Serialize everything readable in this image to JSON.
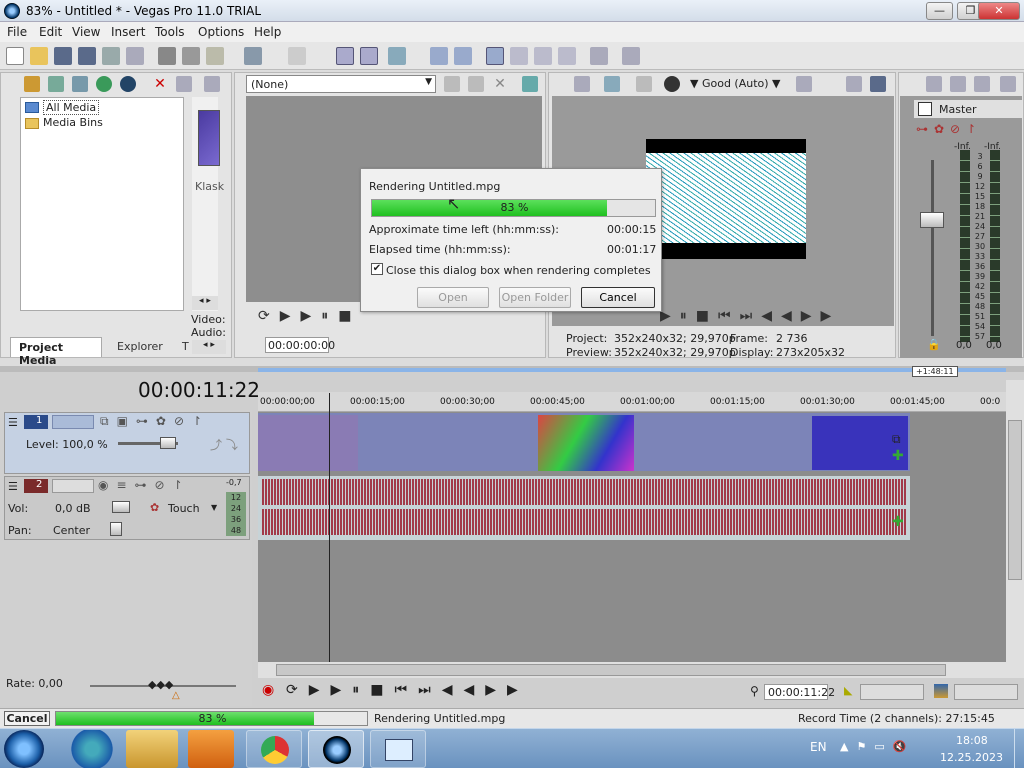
{
  "window": {
    "title": "83% - Untitled * - Vegas Pro 11.0 TRIAL",
    "minimize": "—",
    "maximize": "❐",
    "close": "✕"
  },
  "menu": [
    "File",
    "Edit",
    "View",
    "Insert",
    "Tools",
    "Options",
    "Help"
  ],
  "project_media": {
    "tree": [
      "All Media",
      "Media Bins"
    ],
    "thumb_label": "Klask",
    "tabs": [
      "Project Media",
      "Explorer",
      "T"
    ],
    "side_labels": [
      "Video:",
      "Audio:"
    ]
  },
  "trimmer": {
    "select_value": "(None)",
    "timecode": "00:00:00:00"
  },
  "preview": {
    "quality": "Good (Auto)",
    "project_label": "Project:",
    "project_value": "352x240x32; 29,970p",
    "preview_label": "Preview:",
    "preview_value": "352x240x32; 29,970p",
    "frame_label": "Frame:",
    "frame_value": "2 736",
    "display_label": "Display:",
    "display_value": "273x205x32"
  },
  "mixer": {
    "title": "Master",
    "inf_left": "-Inf.",
    "inf_right": "-Inf.",
    "scale": [
      "3",
      "6",
      "9",
      "12",
      "15",
      "18",
      "21",
      "24",
      "27",
      "30",
      "33",
      "36",
      "39",
      "42",
      "45",
      "48",
      "51",
      "54",
      "57"
    ],
    "bottom_left": "0,0",
    "bottom_right": "0,0"
  },
  "timeline": {
    "timecode": "00:00:11:22",
    "region_marker": "+1:48:11",
    "ruler": [
      "00:00:00;00",
      "00:00:15;00",
      "00:00:30;00",
      "00:00:45;00",
      "00:01:00;00",
      "00:01:15;00",
      "00:01:30;00",
      "00:01:45;00",
      "00:0"
    ]
  },
  "tracks": {
    "video": {
      "number": "1",
      "level": "Level: 100,0 %"
    },
    "audio": {
      "number": "2",
      "vol_label": "Vol:",
      "vol_value": "0,0 dB",
      "pan_label": "Pan:",
      "pan_value": "Center",
      "touch": "Touch",
      "meter_top": "-0,7",
      "meter_scale": [
        "12",
        "24",
        "36",
        "48"
      ]
    }
  },
  "transport": {
    "rate": "Rate: 0,00",
    "timecode": "00:00:11:22"
  },
  "status": {
    "cancel": "Cancel",
    "progress": 83,
    "progress_text": "83 %",
    "rendering": "Rendering Untitled.mpg",
    "record_time": "Record Time (2 channels): 27:15:45"
  },
  "dialog": {
    "title": "Rendering Untitled.mpg",
    "progress": 83,
    "progress_text": "83 %",
    "time_left_label": "Approximate time left (hh:mm:ss):",
    "time_left_value": "00:00:15",
    "elapsed_label": "Elapsed time (hh:mm:ss):",
    "elapsed_value": "00:01:17",
    "checkbox_label": "Close this dialog box when rendering completes",
    "checkbox_checked": true,
    "open": "Open",
    "open_folder": "Open Folder",
    "cancel": "Cancel"
  },
  "taskbar": {
    "lang": "EN",
    "time": "18:08",
    "date": "12.25.2023"
  },
  "colors": {
    "progress_green": "#1fc01f",
    "audio_wave": "#a23a4a",
    "video_track": "#7c84b8",
    "taskbar": "#6a92bf"
  }
}
